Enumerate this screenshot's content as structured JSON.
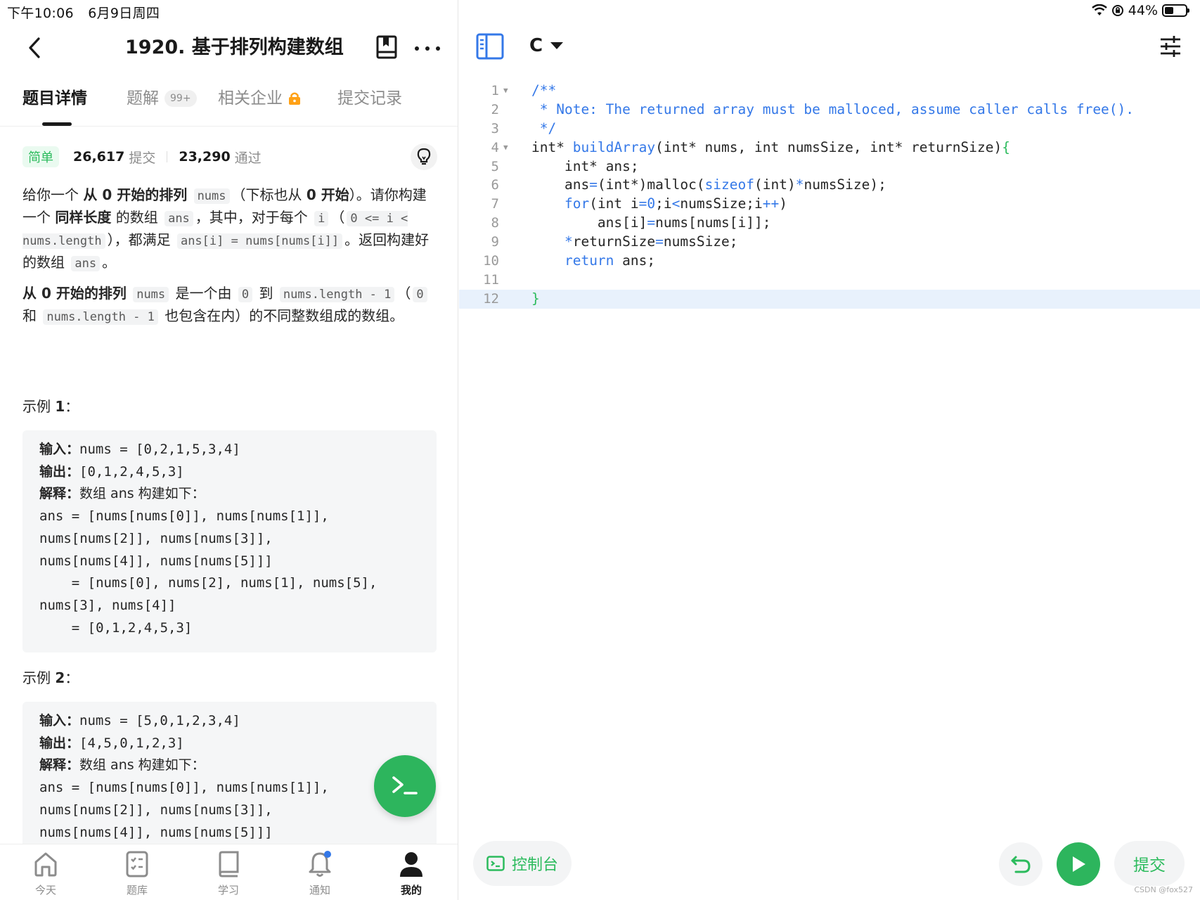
{
  "status": {
    "time": "下午10:06",
    "date": "6月9日周四",
    "battery": "44%",
    "battery_level": 0.44
  },
  "header": {
    "title": "1920. 基于排列构建数组"
  },
  "tabs": [
    {
      "label": "题目详情"
    },
    {
      "label": "题解",
      "badge": "99+"
    },
    {
      "label": "相关企业"
    },
    {
      "label": "提交记录"
    }
  ],
  "stats": {
    "difficulty": "简单",
    "submissions": "26,617",
    "submissions_label": "提交",
    "accepted": "23,290",
    "accepted_label": "通过"
  },
  "desc": {
    "p1": [
      "给你一个 ",
      "从 0 开始的排列",
      " ",
      "nums",
      "（下标也从 ",
      "0 开始",
      "）。请你构建一个 ",
      "同样长度",
      " 的数组 ",
      "ans",
      "，其中，对于每个 ",
      "i",
      "（",
      "0 <= i < nums.length",
      "），都满足 ",
      "ans[i] = nums[nums[i]]",
      "。返回构建好的数组 ",
      "ans",
      "。"
    ],
    "p2": [
      "从 0 开始的排列",
      " ",
      "nums",
      " 是一个由 ",
      "0",
      " 到 ",
      "nums.length - 1",
      "（",
      "0",
      " 和 ",
      "nums.length - 1",
      " 也包含在内）的不同整数组成的数组。"
    ]
  },
  "examples": [
    {
      "title": "示例 ",
      "num": "1",
      "colon": "：",
      "input_label": "输入：",
      "input": "nums = [0,2,1,5,3,4]",
      "output_label": "输出：",
      "output": "[0,1,2,4,5,3]",
      "explain_label": "解释：",
      "explain": "数组 ans 构建如下：",
      "lines": [
        "ans = [nums[nums[0]], nums[nums[1]],",
        "nums[nums[2]], nums[nums[3]],",
        "nums[nums[4]], nums[nums[5]]]",
        "    = [nums[0], nums[2], nums[1], nums[5],",
        "nums[3], nums[4]]",
        "    = [0,1,2,4,5,3]"
      ]
    },
    {
      "title": "示例 ",
      "num": "2",
      "colon": "：",
      "input_label": "输入：",
      "input": "nums = [5,0,1,2,3,4]",
      "output_label": "输出：",
      "output": "[4,5,0,1,2,3]",
      "explain_label": "解释：",
      "explain": "数组 ans 构建如下：",
      "lines": [
        "ans = [nums[nums[0]], nums[nums[1]],",
        "nums[nums[2]], nums[nums[3]],",
        "nums[nums[4]], nums[nums[5]]]"
      ]
    }
  ],
  "bottom_nav": [
    {
      "label": "今天",
      "icon": "home-icon"
    },
    {
      "label": "题库",
      "icon": "problem-list-icon"
    },
    {
      "label": "学习",
      "icon": "book-icon"
    },
    {
      "label": "通知",
      "icon": "bell-icon"
    },
    {
      "label": "我的",
      "icon": "profile-icon",
      "active": true
    }
  ],
  "editor": {
    "language": "C",
    "line_numbers": [
      "1",
      "2",
      "3",
      "4",
      "5",
      "6",
      "7",
      "8",
      "9",
      "10",
      "11",
      "12"
    ],
    "code": [
      "/**",
      " * Note: The returned array must be malloced, assume caller calls free().",
      " */",
      "int* buildArray(int* nums, int numsSize, int* returnSize){",
      "    int* ans;",
      "    ans=(int*)malloc(sizeof(int)*numsSize);",
      "    for(int i=0;i<numsSize;i++)",
      "        ans[i]=nums[nums[i]];",
      "    *returnSize=numsSize;",
      "    return ans;",
      "",
      "}"
    ],
    "console_label": "控制台",
    "submit_label": "提交"
  },
  "watermark": "CSDN @fox527",
  "colors": {
    "accent": "#2db55d",
    "keyword": "#3478e8",
    "current_line": "#e8f1fc",
    "lock": "#ffa116"
  }
}
